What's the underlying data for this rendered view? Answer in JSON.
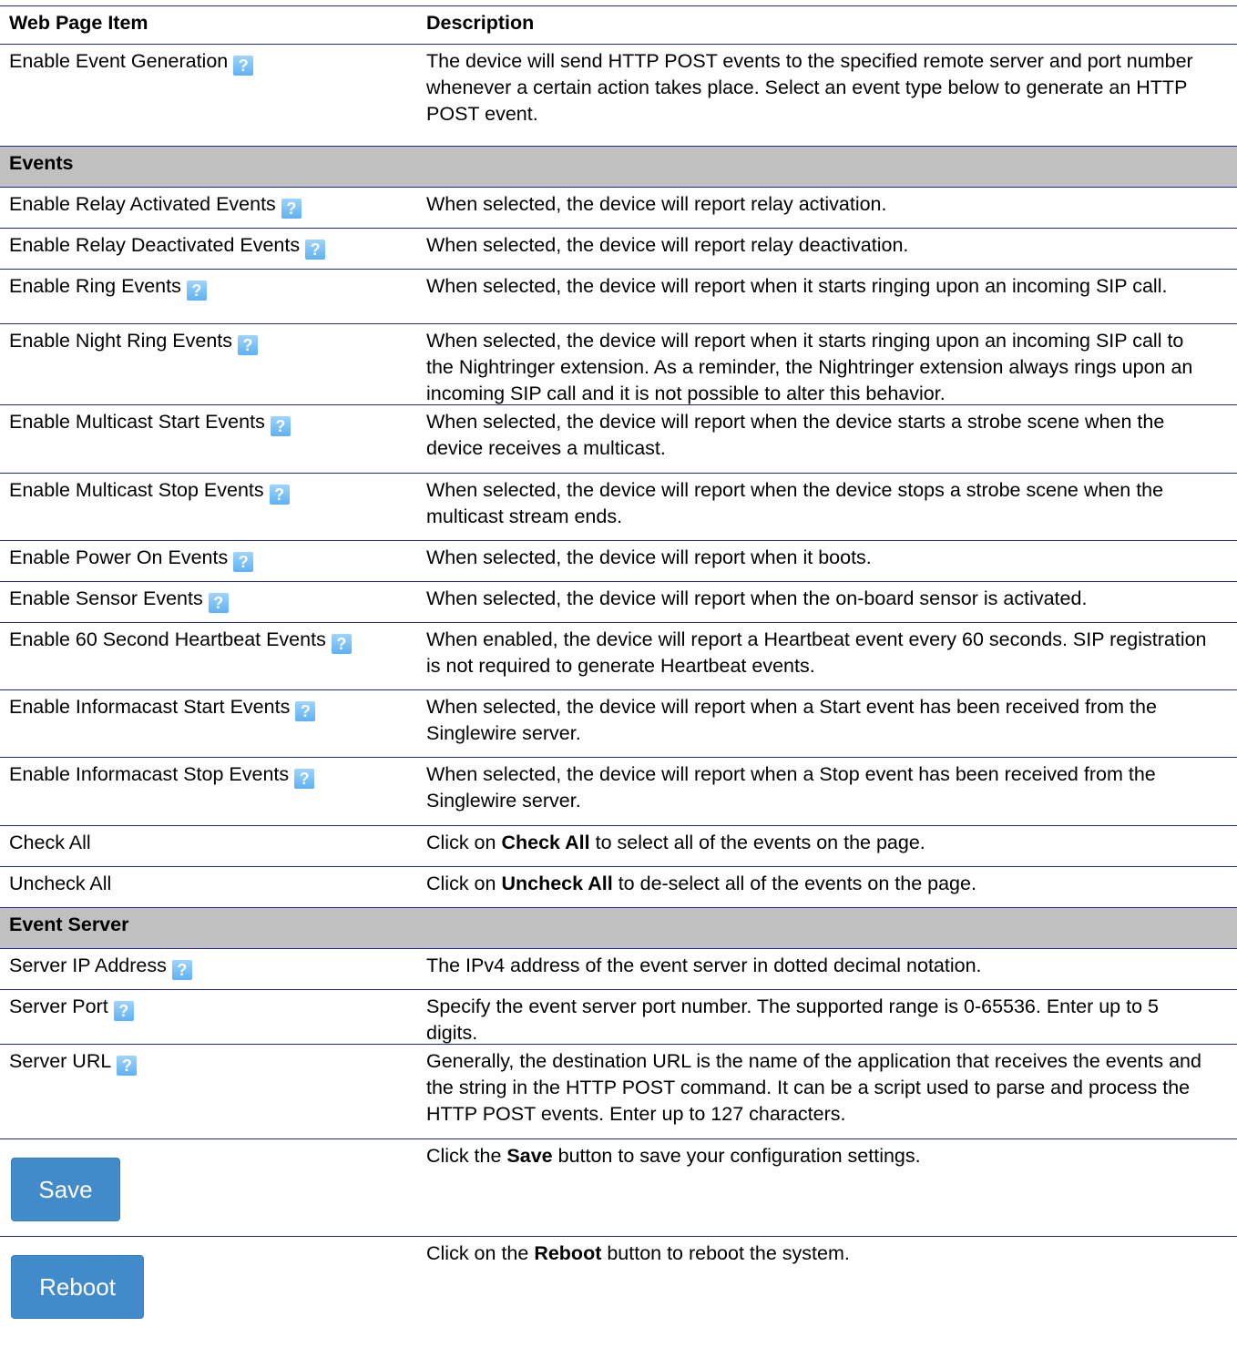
{
  "header": {
    "col1": "Web Page Item",
    "col2": "Description"
  },
  "intro": {
    "item": "Enable Event Generation",
    "desc": "The device will send HTTP POST events to the specified remote server and port number whenever a certain action takes place. Select an event type below to generate an HTTP POST event."
  },
  "help_icon": {
    "glyph": "?",
    "icon": "question-mark-icon",
    "color": "#6cb8f5"
  },
  "events_section": {
    "title": "Events",
    "rows": [
      {
        "item": "Enable Relay Activated Events",
        "desc": "When selected, the device will report relay activation.",
        "help": true
      },
      {
        "item": "Enable Relay Deactivated Events",
        "desc": "When selected, the device will report relay deactivation.",
        "help": true
      },
      {
        "item": "Enable Ring Events",
        "desc": "When selected, the device will report when it starts ringing upon an incoming SIP call.",
        "help": true
      },
      {
        "item": "Enable Night Ring Events",
        "desc": "When selected, the device will report when it starts ringing upon an incoming SIP call to the Nightringer extension. As a reminder, the Nightringer extension always rings upon an incoming SIP call and it is not possible to alter this behavior.",
        "help": true
      },
      {
        "item": "Enable Multicast Start Events",
        "desc": "When selected, the device will report when the device starts a strobe scene when the device receives a multicast.",
        "help": true
      },
      {
        "item": "Enable Multicast Stop Events",
        "desc": "When selected, the device will report when the device stops a strobe scene when the multicast stream ends.",
        "help": true
      },
      {
        "item": "Enable Power On Events",
        "desc": "When selected, the device will report when it boots.",
        "help": true
      },
      {
        "item": "Enable Sensor Events",
        "desc": "When selected, the device will report when the on-board sensor is activated.",
        "help": true
      },
      {
        "item": "Enable 60 Second Heartbeat Events",
        "desc": "When enabled, the device will report a Heartbeat event every 60 seconds. SIP registration is not required to generate Heartbeat events.",
        "help": true
      },
      {
        "item": "Enable Informacast Start Events",
        "desc": "When selected, the device will report when a Start event has been received from the Singlewire server.",
        "help": true
      },
      {
        "item": "Enable Informacast Stop Events",
        "desc": "When selected, the device will report when a Stop event has been received from the Singlewire server.",
        "help": true
      },
      {
        "item": "Check All",
        "desc_pre": "Click on ",
        "desc_bold": "Check All",
        "desc_post": " to select all of the events on the page.",
        "help": false
      },
      {
        "item": "Uncheck All",
        "desc_pre": "Click on ",
        "desc_bold": "Uncheck All",
        "desc_post": " to de-select all of the events on the page.",
        "help": false
      }
    ]
  },
  "server_section": {
    "title": "Event Server",
    "rows": [
      {
        "item": "Server IP Address",
        "desc": "The IPv4 address of the event server in dotted decimal notation.",
        "help": true
      },
      {
        "item": "Server Port",
        "desc": "Specify the event server port number. The supported range is 0-65536. Enter up to 5 digits.",
        "help": true
      },
      {
        "item": "Server URL",
        "desc": "Generally, the destination URL is the name of the application that receives the events and the string in the HTTP POST command. It can be a script used to parse and process the HTTP POST events. Enter up to 127 characters.",
        "help": true
      }
    ]
  },
  "save": {
    "label": "Save",
    "desc_pre": "Click the ",
    "desc_bold": "Save",
    "desc_post": " button to save your configuration settings."
  },
  "reboot": {
    "label": "Reboot",
    "desc_pre": "Click on the ",
    "desc_bold": "Reboot",
    "desc_post": " button to reboot the system."
  },
  "colors": {
    "rule": "#1f2a86",
    "section_bg": "#c0c0c0",
    "button_bg": "#428bca",
    "button_text": "#ffffff"
  }
}
